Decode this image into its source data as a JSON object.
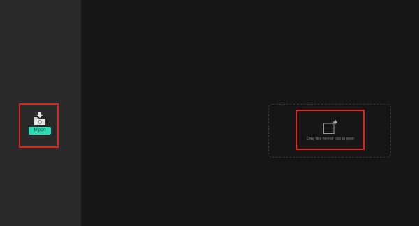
{
  "colors": {
    "sidebar_bg": "#292929",
    "main_bg": "#161616",
    "accent": "#2ddbb4",
    "highlight": "#e0241b",
    "muted_text": "#8a8a8a"
  },
  "sidebar": {
    "import_icon": "import-folder-icon",
    "import_label": "Import"
  },
  "dropzone": {
    "icon": "add-file-icon",
    "text": "Drag files here or click to open"
  }
}
